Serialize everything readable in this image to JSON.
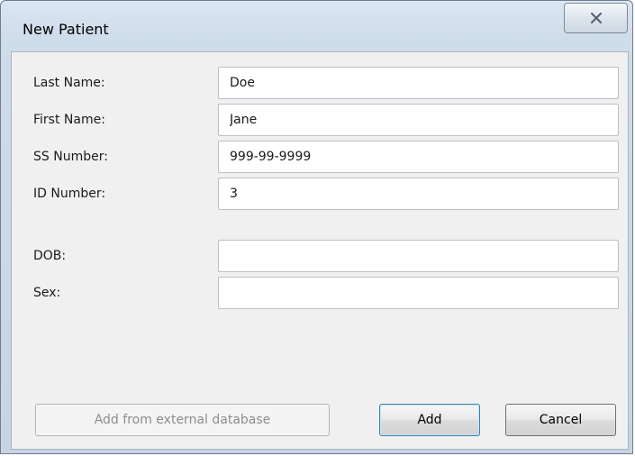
{
  "window": {
    "title": "New Patient",
    "close_icon": "close-x-icon"
  },
  "form": {
    "fields": [
      {
        "label": "Last Name:",
        "value": "Doe",
        "placeholder": ""
      },
      {
        "label": "First Name:",
        "value": "Jane",
        "placeholder": ""
      },
      {
        "label": "SS Number:",
        "value": "999-99-9999",
        "placeholder": ""
      },
      {
        "label": "ID Number:",
        "value": "3",
        "placeholder": ""
      },
      {
        "label": "DOB:",
        "value": "",
        "placeholder": ""
      },
      {
        "label": "Sex:",
        "value": "",
        "placeholder": ""
      }
    ]
  },
  "buttons": {
    "external_label": "Add from external database",
    "external_enabled": false,
    "add_label": "Add",
    "cancel_label": "Cancel"
  },
  "colors": {
    "chrome": "#cfdcea",
    "client_bg": "#f0f0f0",
    "field_bg": "#ffffff"
  }
}
